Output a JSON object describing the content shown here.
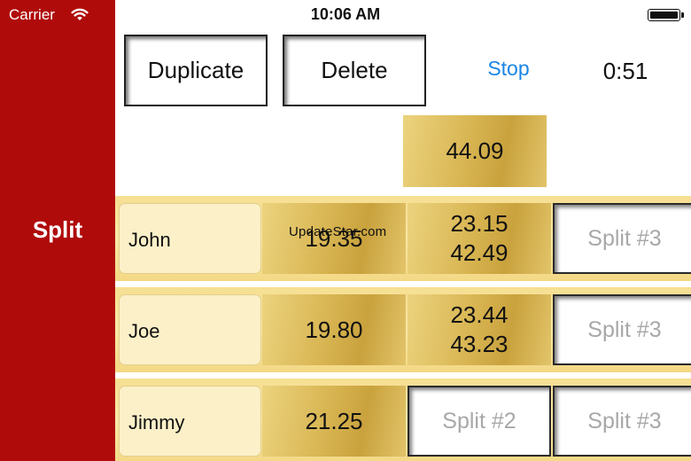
{
  "status_bar": {
    "carrier": "Carrier",
    "time": "10:06 AM"
  },
  "sidebar": {
    "label": "Split",
    "color": "#b00b0b"
  },
  "toolbar": {
    "duplicate_label": "Duplicate",
    "delete_label": "Delete",
    "stop_label": "Stop",
    "timer": "0:51",
    "link_color": "#1a85e6"
  },
  "total": "44.09",
  "watermark": "UpdateStar.com",
  "rows": [
    {
      "name": "John",
      "split1": "19.35",
      "split2_lines": [
        "23.15",
        "42.49"
      ],
      "split3_placeholder": "Split #3"
    },
    {
      "name": "Joe",
      "split1": "19.80",
      "split2_lines": [
        "23.44",
        "43.23"
      ],
      "split3_placeholder": "Split #3"
    },
    {
      "name": "Jimmy",
      "split1": "21.25",
      "split2_placeholder": "Split #2",
      "split3_placeholder": "Split #3"
    }
  ]
}
